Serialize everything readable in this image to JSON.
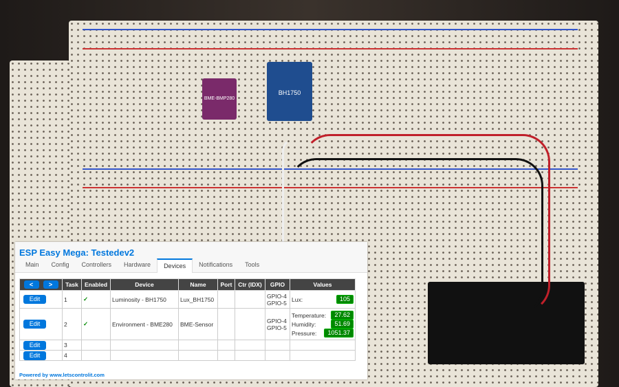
{
  "photo": {
    "chip1_label": "BH1750",
    "chip2_label": "BME-BMP280"
  },
  "app": {
    "title": "ESP Easy Mega: Testedev2"
  },
  "tabs": [
    {
      "label": "Main"
    },
    {
      "label": "Config"
    },
    {
      "label": "Controllers"
    },
    {
      "label": "Hardware"
    },
    {
      "label": "Devices",
      "active": true
    },
    {
      "label": "Notifications"
    },
    {
      "label": "Tools"
    }
  ],
  "table": {
    "prev": "<",
    "next": ">",
    "headers": [
      "Task",
      "Enabled",
      "Device",
      "Name",
      "Port",
      "Ctr (IDX)",
      "GPIO",
      "Values"
    ],
    "edit_label": "Edit",
    "rows": [
      {
        "task": "1",
        "enabled": "✓",
        "device": "Luminosity - BH1750",
        "name": "Lux_BH1750",
        "port": "",
        "ctr": "",
        "gpio": [
          "GPIO-4",
          "GPIO-5"
        ],
        "values": [
          {
            "label": "Lux:",
            "value": "105"
          }
        ]
      },
      {
        "task": "2",
        "enabled": "✓",
        "device": "Environment - BME280",
        "name": "BME-Sensor",
        "port": "",
        "ctr": "",
        "gpio": [
          "GPIO-4",
          "GPIO-5"
        ],
        "values": [
          {
            "label": "Temperature:",
            "value": "27.62"
          },
          {
            "label": "Humidity:",
            "value": "51.69"
          },
          {
            "label": "Pressure:",
            "value": "1051.37"
          }
        ]
      },
      {
        "task": "3"
      },
      {
        "task": "4"
      }
    ]
  },
  "footer": "Powered by www.letscontrolit.com",
  "colors": {
    "accent": "#0077dd",
    "badge": "#008800",
    "header": "#444444"
  }
}
